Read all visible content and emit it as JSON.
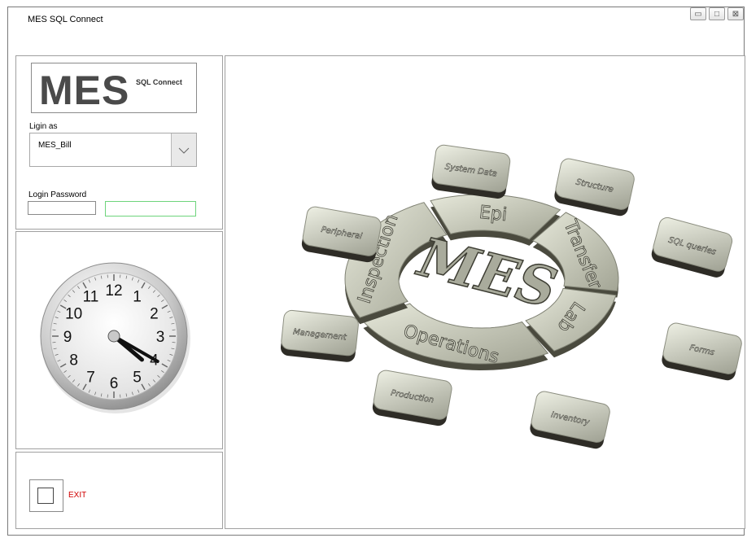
{
  "window": {
    "title": "MES SQL Connect",
    "controls": {
      "minimize": "▭",
      "maximize": "□",
      "close": "⊠"
    }
  },
  "logo": {
    "main": "MES",
    "sub": "SQL Connect"
  },
  "login": {
    "login_as_label": "Ligin as",
    "user_value": "MES_Bill",
    "password_label": "Login Password",
    "password_value": "",
    "confirm_value": ""
  },
  "clock": {
    "numbers": [
      "12",
      "1",
      "2",
      "3",
      "4",
      "5",
      "6",
      "7",
      "8",
      "9",
      "10",
      "11"
    ],
    "hour": 4,
    "minute": 20,
    "second": 0
  },
  "exit": {
    "label": "EXIT"
  },
  "diagram": {
    "center": "MES",
    "ring": [
      "Epi",
      "Transfer",
      "Lab",
      "Operations",
      "Inspection"
    ],
    "tiles": [
      "System Data",
      "Structure",
      "SQL queries",
      "Forms",
      "Inventory",
      "Production",
      "Management",
      "Peripheral"
    ]
  }
}
